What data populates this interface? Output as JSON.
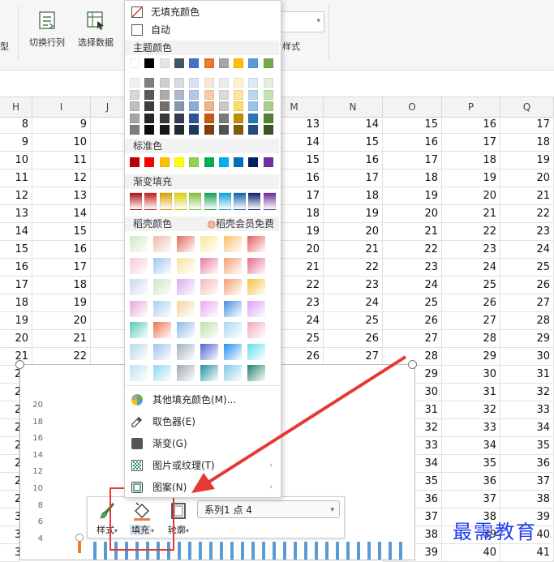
{
  "ribbon": {
    "left_partial_label": "型",
    "switch_rowcol_label": "切换行列",
    "select_data_label": "选择数据",
    "style_label": "样式"
  },
  "grid": {
    "columns": [
      "H",
      "I",
      "J",
      "M",
      "N",
      "O",
      "P",
      "Q"
    ],
    "rows": [
      [
        "8",
        "9",
        "13",
        "14",
        "15",
        "16",
        "17"
      ],
      [
        "9",
        "10",
        "14",
        "15",
        "16",
        "17",
        "18"
      ],
      [
        "10",
        "11",
        "15",
        "16",
        "17",
        "18",
        "19"
      ],
      [
        "11",
        "12",
        "16",
        "17",
        "18",
        "19",
        "20"
      ],
      [
        "12",
        "13",
        "17",
        "18",
        "19",
        "20",
        "21"
      ],
      [
        "13",
        "14",
        "18",
        "19",
        "20",
        "21",
        "22"
      ],
      [
        "14",
        "15",
        "19",
        "20",
        "21",
        "22",
        "23"
      ],
      [
        "15",
        "16",
        "20",
        "21",
        "22",
        "23",
        "24"
      ],
      [
        "16",
        "17",
        "21",
        "22",
        "23",
        "24",
        "25"
      ],
      [
        "17",
        "18",
        "22",
        "23",
        "24",
        "25",
        "26"
      ],
      [
        "18",
        "19",
        "23",
        "24",
        "25",
        "26",
        "27"
      ],
      [
        "19",
        "20",
        "24",
        "25",
        "26",
        "27",
        "28"
      ],
      [
        "20",
        "21",
        "25",
        "26",
        "27",
        "28",
        "29"
      ],
      [
        "21",
        "22",
        "26",
        "27",
        "28",
        "29",
        "30"
      ]
    ],
    "right_rows": [
      [
        "29",
        "30",
        "31"
      ],
      [
        "30",
        "31",
        "32"
      ],
      [
        "31",
        "32",
        "33"
      ],
      [
        "32",
        "33",
        "34"
      ],
      [
        "33",
        "34",
        "35"
      ],
      [
        "34",
        "35",
        "36"
      ],
      [
        "35",
        "36",
        "37"
      ],
      [
        "36",
        "37",
        "38"
      ],
      [
        "37",
        "38",
        "39"
      ],
      [
        "38",
        "39",
        "40"
      ],
      [
        "39",
        "40",
        "41"
      ]
    ],
    "left_partial": [
      "2",
      "2",
      "2",
      "2",
      "2",
      "2",
      "2",
      "2",
      "3",
      "3",
      "3"
    ]
  },
  "chart": {
    "y_ticks": [
      "20",
      "18",
      "16",
      "14",
      "12",
      "10",
      "8",
      "6",
      "4"
    ],
    "bar_heights_relative": [
      0.62,
      0.62,
      0.62,
      0.62,
      0.62,
      0.62,
      0.62,
      0.62,
      0.62,
      0.62,
      0.62,
      0.62,
      0.62,
      0.62,
      0.62,
      0.62,
      0.62,
      0.62,
      0.62,
      0.62,
      0.62,
      0.62,
      0.62,
      0.62,
      0.62,
      0.62,
      0.62,
      0.62,
      0.62,
      0.62
    ]
  },
  "menu": {
    "no_fill": "无填充颜色",
    "auto": "自动",
    "theme_colors_title": "主题颜色",
    "standard_colors_title": "标准色",
    "gradient_fill_title": "渐变填充",
    "daoke_colors_title": "稻壳颜色",
    "member_free": "稻壳会员免费",
    "more_fill_colors": "其他填充颜色(M)...",
    "eyedropper": "取色器(E)",
    "gradient": "渐变(G)",
    "picture_texture": "图片或纹理(T)",
    "pattern": "图案(N)",
    "theme_top": [
      "#ffffff",
      "#000000",
      "#e7e6e6",
      "#44546a",
      "#4472c4",
      "#ed7d31",
      "#a5a5a5",
      "#ffc000",
      "#5b9bd5",
      "#70ad47"
    ],
    "theme_shades": [
      [
        "#f2f2f2",
        "#808080",
        "#d0cece",
        "#d6dce4",
        "#d9e2f3",
        "#fbe5d5",
        "#ededed",
        "#fff2cc",
        "#deebf6",
        "#e2efd9"
      ],
      [
        "#d8d8d8",
        "#595959",
        "#aeabab",
        "#adb9ca",
        "#b4c6e7",
        "#f7cbac",
        "#dbdbdb",
        "#fee599",
        "#bdd7ee",
        "#c5e0b3"
      ],
      [
        "#bfbfbf",
        "#3f3f3f",
        "#757070",
        "#8496b0",
        "#8eaadb",
        "#f4b183",
        "#c9c9c9",
        "#ffd965",
        "#9cc3e5",
        "#a8d08d"
      ],
      [
        "#a5a5a5",
        "#262626",
        "#3a3838",
        "#323f4f",
        "#2f5496",
        "#c55a11",
        "#7b7b7b",
        "#bf9000",
        "#2e75b5",
        "#538135"
      ],
      [
        "#7f7f7f",
        "#0c0c0c",
        "#171616",
        "#222a35",
        "#1f3864",
        "#833c0b",
        "#525252",
        "#7f6000",
        "#1e4e79",
        "#375623"
      ]
    ],
    "standard": [
      "#c00000",
      "#ff0000",
      "#ffc000",
      "#ffff00",
      "#92d050",
      "#00b050",
      "#00b0f0",
      "#0070c0",
      "#002060",
      "#7030a0"
    ],
    "gradients": [
      "#b01010",
      "#c91a1a",
      "#d9a000",
      "#d7cf00",
      "#7fbf3a",
      "#10a050",
      "#10a0d8",
      "#1060b0",
      "#0e1e6e",
      "#6a2a9a"
    ],
    "daoke_grid": [
      [
        "#cfe8c8",
        "#f2b8a8",
        "#e36a5c",
        "#f7e79a",
        "#fbbf6a",
        "#e65a5a"
      ],
      [
        "#f6c7d8",
        "#9ec6ef",
        "#f9e0a0",
        "#e87a9a",
        "#f3a070",
        "#e06a8a"
      ],
      [
        "#c9d6f2",
        "#cde6c4",
        "#d9a8f2",
        "#f6b8b8",
        "#f3a070",
        "#f7c040"
      ],
      [
        "#e8a8d8",
        "#a8cff2",
        "#f7d2a0",
        "#e8a8f0",
        "#4090e0",
        "#d8a0f0"
      ],
      [
        "#58c8b8",
        "#f07050",
        "#8cb8e8",
        "#b8e0a8",
        "#a8d8f0",
        "#f2a8b8"
      ],
      [
        "#b8d8e8",
        "#a0c0f0",
        "#9fb0c0",
        "#5060d0",
        "#2090f0",
        "#60e0f0"
      ],
      [
        "#c0e0f0",
        "#90d8f0",
        "#a0a8b0",
        "#2090a0",
        "#80c8e8",
        "#208070"
      ]
    ]
  },
  "minibar": {
    "style_label": "样式",
    "fill_label": "填充",
    "outline_label": "轮廓",
    "series_value": "系列1 点 4"
  },
  "watermark": "最需教育"
}
